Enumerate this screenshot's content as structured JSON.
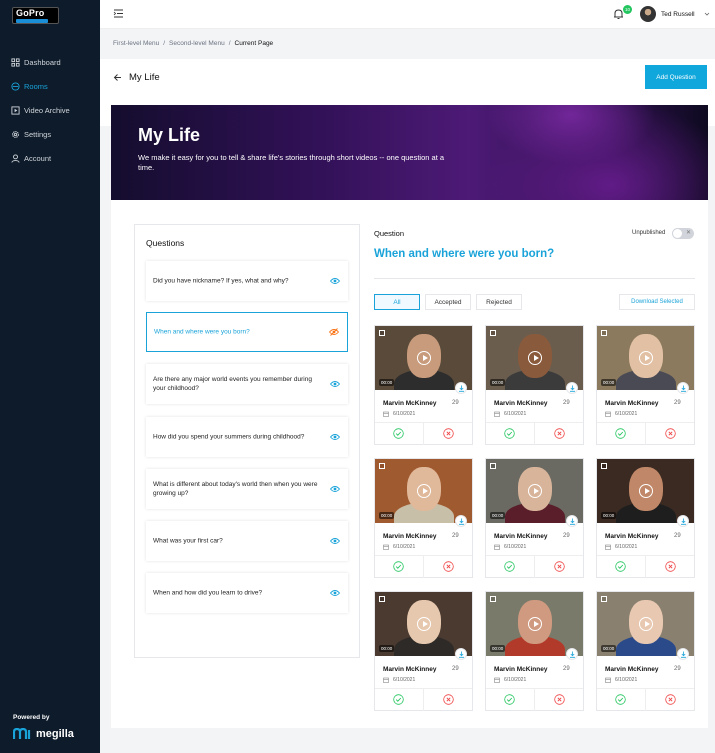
{
  "brand": {
    "logo_text": "GoPro",
    "powered_by": "Powered by",
    "partner": "megilla"
  },
  "sidebar": {
    "items": [
      {
        "label": "Dashboard",
        "icon": "grid-icon",
        "active": false
      },
      {
        "label": "Rooms",
        "icon": "rooms-icon",
        "active": true
      },
      {
        "label": "Video Archive",
        "icon": "video-icon",
        "active": false
      },
      {
        "label": "Settings",
        "icon": "gear-icon",
        "active": false
      },
      {
        "label": "Account",
        "icon": "user-icon",
        "active": false
      }
    ]
  },
  "topbar": {
    "notifications": "10",
    "user_name": "Ted Russell"
  },
  "breadcrumb": {
    "level1": "First-level Menu",
    "sep1": "/",
    "level2": "Second-level Menu",
    "sep2": "/",
    "current": "Current Page"
  },
  "page": {
    "title": "My Life",
    "add_button": "Add Question"
  },
  "hero": {
    "title": "My Life",
    "subtitle": "We make it easy for you to tell & share life's stories through short videos -- one question at a time."
  },
  "questions": {
    "title": "Questions",
    "items": [
      {
        "text": "Did you have nickname? If yes, what and why?",
        "active": false
      },
      {
        "text": "When and where were you born?",
        "active": true
      },
      {
        "text": "Are there any major world events you remember during your childhood?",
        "active": false
      },
      {
        "text": "How did you spend your summers during childhood?",
        "active": false
      },
      {
        "text": "What is different about today's world then when you were growing up?",
        "active": false
      },
      {
        "text": "What was your first car?",
        "active": false
      },
      {
        "text": "When and how did you learn to drive?",
        "active": false
      }
    ]
  },
  "detail": {
    "label": "Question",
    "status": "Unpublished",
    "toggle_symbol": "✕",
    "title": "When and where were you born?",
    "filters": [
      "All",
      "Accepted",
      "Rejected"
    ],
    "download_label": "Download Selected"
  },
  "videos": [
    {
      "name": "Marvin McKinney",
      "count": "29",
      "date": "6/10/2021",
      "duration": "00:00",
      "skin": "#c79b7b",
      "bg": "#5a4a3a",
      "shirt": "#2d2d2d"
    },
    {
      "name": "Marvin McKinney",
      "count": "29",
      "date": "6/10/2021",
      "duration": "00:00",
      "skin": "#8a5a3c",
      "bg": "#6b5d4e",
      "shirt": "#3b3b3b"
    },
    {
      "name": "Marvin McKinney",
      "count": "29",
      "date": "6/10/2021",
      "duration": "00:00",
      "skin": "#e2c0a4",
      "bg": "#8b7a5e",
      "shirt": "#4a4a55"
    },
    {
      "name": "Marvin McKinney",
      "count": "29",
      "date": "6/10/2021",
      "duration": "00:00",
      "skin": "#e0b89a",
      "bg": "#a05a30",
      "shirt": "#c8bfa8"
    },
    {
      "name": "Marvin McKinney",
      "count": "29",
      "date": "6/10/2021",
      "duration": "00:00",
      "skin": "#d8b49a",
      "bg": "#6a6a62",
      "shirt": "#5a1e2a"
    },
    {
      "name": "Marvin McKinney",
      "count": "29",
      "date": "6/10/2021",
      "duration": "00:00",
      "skin": "#c08868",
      "bg": "#3a2a22",
      "shirt": "#1e1e1e"
    },
    {
      "name": "Marvin McKinney",
      "count": "29",
      "date": "6/10/2021",
      "duration": "00:00",
      "skin": "#e6c8ae",
      "bg": "#4a3a30",
      "shirt": "#2e2a28"
    },
    {
      "name": "Marvin McKinney",
      "count": "29",
      "date": "6/10/2021",
      "duration": "00:00",
      "skin": "#cf9a80",
      "bg": "#7a7a6a",
      "shirt": "#b23a2a"
    },
    {
      "name": "Marvin McKinney",
      "count": "29",
      "date": "6/10/2021",
      "duration": "00:00",
      "skin": "#e8c8b0",
      "bg": "#8a8070",
      "shirt": "#2a4a8a"
    }
  ]
}
